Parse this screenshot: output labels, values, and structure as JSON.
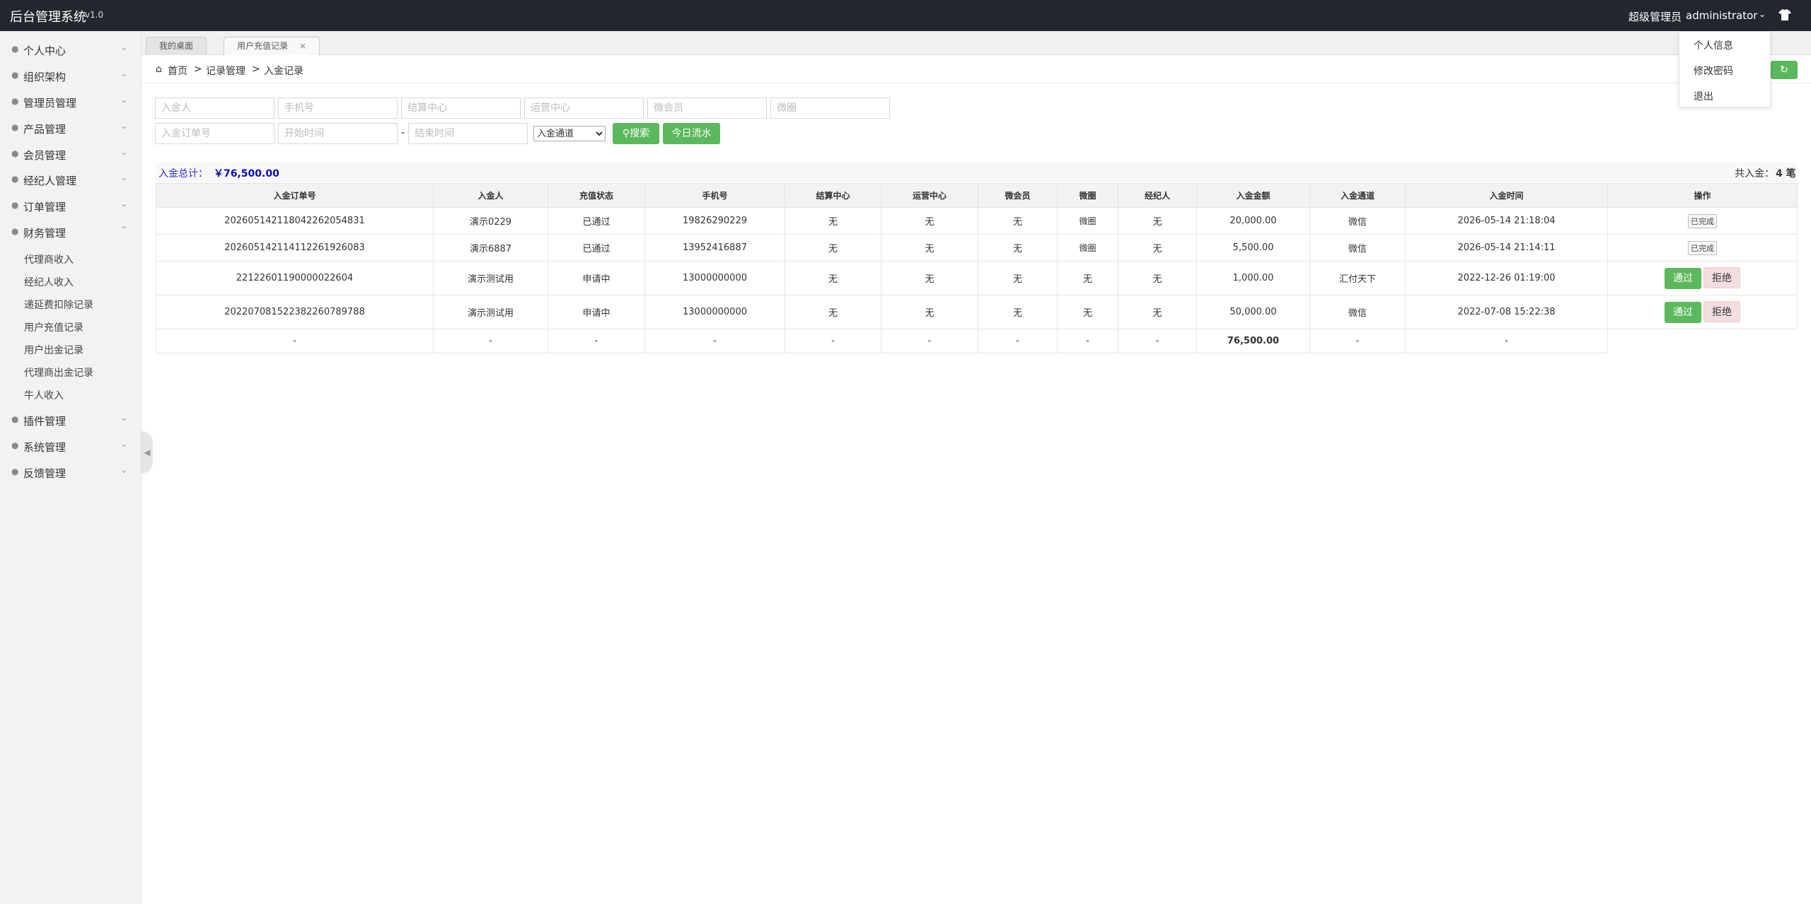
{
  "header": {
    "title": "后台管理系统",
    "version": "v1.0",
    "role": "超级管理员",
    "username": "administrator",
    "shirt_icon": "shirt-icon"
  },
  "user_menu": [
    "个人信息",
    "修改密码",
    "退出"
  ],
  "sidebar": {
    "items": [
      {
        "label": "个人中心",
        "icon": "user-icon"
      },
      {
        "label": "组织架构",
        "icon": "org-icon"
      },
      {
        "label": "管理员管理",
        "icon": "admin-icon"
      },
      {
        "label": "产品管理",
        "icon": "lock-icon"
      },
      {
        "label": "会员管理",
        "icon": "member-icon"
      },
      {
        "label": "经纪人管理",
        "icon": "broker-icon"
      },
      {
        "label": "订单管理",
        "icon": "order-icon"
      },
      {
        "label": "财务管理",
        "icon": "finance-icon"
      }
    ],
    "finance_sub": [
      "代理商收入",
      "经纪人收入",
      "递延费扣除记录",
      "用户充值记录",
      "用户出金记录",
      "代理商出金记录",
      "牛人收入"
    ],
    "items_after": [
      {
        "label": "插件管理",
        "icon": "plugin-icon"
      },
      {
        "label": "系统管理",
        "icon": "gear-icon"
      },
      {
        "label": "反馈管理",
        "icon": "feedback-icon"
      }
    ]
  },
  "tabs": [
    {
      "label": "我的桌面"
    },
    {
      "label": "用户充值记录",
      "close": "×"
    }
  ],
  "breadcrumb": {
    "home": "首页",
    "sep": ">",
    "section": "记录管理",
    "page": "入金记录"
  },
  "filters": {
    "row1": [
      "入金人",
      "手机号",
      "结算中心",
      "运营中心",
      "微会员",
      "微圈"
    ],
    "order_no": "入金订单号",
    "start_time": "开始时间",
    "dash": "-",
    "end_time": "结束时间",
    "channel_selected": "入金通道",
    "search_label": "搜索",
    "today_label": "今日流水"
  },
  "summary": {
    "total_label": "入金总计：",
    "total_value": "￥76,500.00",
    "count_label": "共入金：",
    "count_value": "4 笔"
  },
  "table": {
    "headers": [
      "入金订单号",
      "入金人",
      "充值状态",
      "手机号",
      "结算中心",
      "运营中心",
      "微会员",
      "微圈",
      "经纪人",
      "入金金额",
      "入金通道",
      "入金时间",
      "操作"
    ],
    "rows": [
      [
        "20260514211804226205483​1",
        "演示0229",
        "已通过",
        "19826290229",
        "无",
        "无",
        "无",
        "微圈",
        "无",
        "20,000.00",
        "微信",
        "2026-05-14 21:18:04",
        "已完成"
      ],
      [
        "202605142114112261926083",
        "演示6887",
        "已通过",
        "13952416887",
        "无",
        "无",
        "无",
        "微圈",
        "无",
        "5,500.00",
        "微信",
        "2026-05-14 21:14:11",
        "已完成"
      ],
      [
        "22122601190000022604",
        "演示测试用",
        "申请中",
        "13000000000",
        "无",
        "无",
        "无",
        "无",
        "无",
        "1,000.00",
        "汇付天下",
        "2022-12-26 01:19:00",
        ""
      ],
      [
        "202207081522382260789788",
        "演示测试用",
        "申请中",
        "13000000000",
        "无",
        "无",
        "无",
        "无",
        "无",
        "50,000.00",
        "微信",
        "2022-07-08 15:22:38",
        ""
      ]
    ],
    "summary_row": [
      "-",
      "-",
      "-",
      "-",
      "-",
      "-",
      "-",
      "-",
      "-",
      "76,500.00",
      "-",
      "-"
    ],
    "pass_label": "通过",
    "reject_label": "拒绝"
  },
  "colors": {
    "topbar": "#23262e",
    "accent_green": "#5cb85c",
    "reject_bg": "#f2dede",
    "total_blue": "#0a0ab8"
  }
}
